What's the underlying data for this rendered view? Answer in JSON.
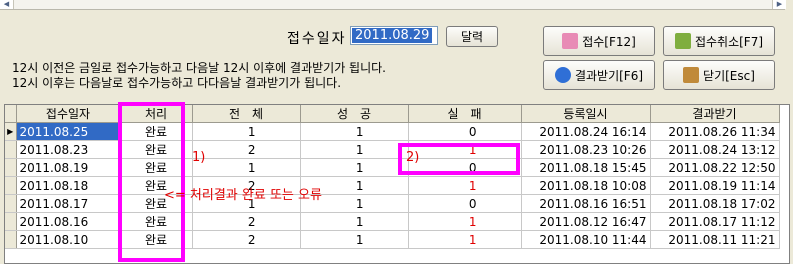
{
  "scrollbar": {
    "left_arrow": "◀",
    "right_arrow": "▶"
  },
  "filter": {
    "label": "접수일자",
    "date_value": "2011.08.29",
    "calendar_button": "달력"
  },
  "actions": {
    "receive": "접수[F12]",
    "cancel_receive": "접수취소[F7]",
    "get_result": "결과받기[F6]",
    "close": "닫기[Esc]"
  },
  "info_lines": [
    "12시 이전은 금일로 접수가능하고 다음날 12시 이후에 결과받기가 됩니다.",
    "12시 이후는 다음날로 접수가능하고 다다음날 결과받기가 됩니다."
  ],
  "table": {
    "columns": [
      "접수일자",
      "처리",
      "전　체",
      "성　공",
      "실　패",
      "등록일시",
      "결과받기"
    ],
    "rows": [
      {
        "date": "2011.08.25",
        "status": "완료",
        "total": "1",
        "success": "1",
        "fail": "0",
        "registered": "2011.08.24 16:14",
        "result": "2011.08.26 11:34"
      },
      {
        "date": "2011.08.23",
        "status": "완료",
        "total": "2",
        "success": "1",
        "fail": "1",
        "registered": "2011.08.23 10:26",
        "result": "2011.08.24 13:12"
      },
      {
        "date": "2011.08.19",
        "status": "완료",
        "total": "1",
        "success": "1",
        "fail": "0",
        "registered": "2011.08.18 15:45",
        "result": "2011.08.22 12:50"
      },
      {
        "date": "2011.08.18",
        "status": "완료",
        "total": "2",
        "success": "1",
        "fail": "1",
        "registered": "2011.08.18 10:08",
        "result": "2011.08.19 11:14"
      },
      {
        "date": "2011.08.17",
        "status": "완료",
        "total": "1",
        "success": "1",
        "fail": "0",
        "registered": "2011.08.16 16:51",
        "result": "2011.08.18 17:02"
      },
      {
        "date": "2011.08.16",
        "status": "완료",
        "total": "2",
        "success": "1",
        "fail": "1",
        "registered": "2011.08.12 16:47",
        "result": "2011.08.17 11:12"
      },
      {
        "date": "2011.08.10",
        "status": "완료",
        "total": "2",
        "success": "1",
        "fail": "1",
        "registered": "2011.08.10 11:44",
        "result": "2011.08.11 11:21"
      }
    ]
  },
  "annotations": {
    "marker1": "1)",
    "marker2": "2)",
    "status_note": "<= 처리결과 완료 또는 오류"
  },
  "colors": {
    "highlight": "#ff00ff",
    "annotation": "#e00000",
    "selection": "#316ac5"
  }
}
